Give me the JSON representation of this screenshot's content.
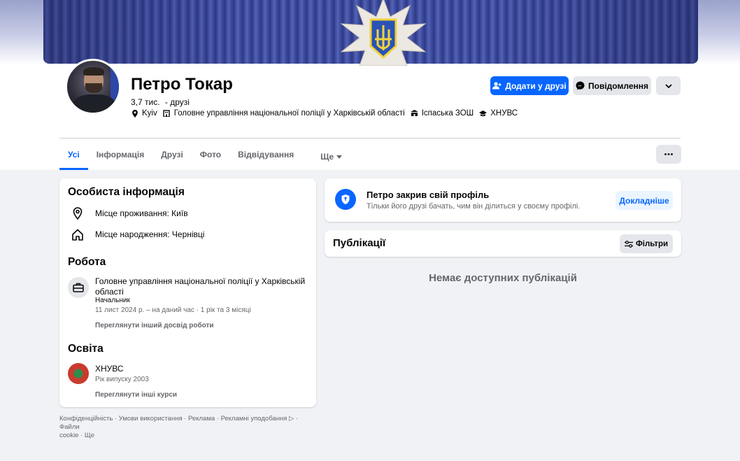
{
  "profile": {
    "name": "Петро Токар",
    "friends_count": "3,7 тис.",
    "friends_label": "- друзі",
    "location": "Kyiv",
    "workplace": "Головне управління національної поліції у Харківській області",
    "school": "Іспаська ЗОШ",
    "university": "ХНУВС"
  },
  "actions": {
    "add_friend": "Додати у друзі",
    "message": "Повідомлення"
  },
  "tabs": [
    {
      "label": "Усі"
    },
    {
      "label": "Інформація"
    },
    {
      "label": "Друзі"
    },
    {
      "label": "Фото"
    },
    {
      "label": "Відвідування"
    },
    {
      "label": "Ще"
    }
  ],
  "personal": {
    "title": "Особиста інформація",
    "residence": "Місце проживання: Київ",
    "birthplace": "Місце народження: Чернівці"
  },
  "work": {
    "title": "Робота",
    "company": "Головне управління національної поліції у Харківській",
    "company_line2": "області",
    "position": "Начальник",
    "period": "11 лист 2024 р. – на даний час · 1 рік та 3 місяці",
    "more_link": "Переглянути інший досвід роботи"
  },
  "education": {
    "title": "Освіта",
    "school": "ХНУВС",
    "year": "Рік випуску 2003",
    "more_link": "Переглянути інші курси"
  },
  "closed_profile": {
    "title": "Петро закрив свій профіль",
    "subtitle": "Тільки його друзі бачать, чим він ділиться у своєму профілі.",
    "button": "Докладніше"
  },
  "posts": {
    "title": "Публікації",
    "filter_button": "Фільтри",
    "empty": "Немає доступних публікацій"
  },
  "footer": {
    "line1": "Конфіденційність · Умови використання · Реклама · Рекламні уподобання ▷ · Файли",
    "line2": "cookie · Ще"
  },
  "colors": {
    "accent": "#0866ff",
    "background": "#f0f2f5"
  }
}
